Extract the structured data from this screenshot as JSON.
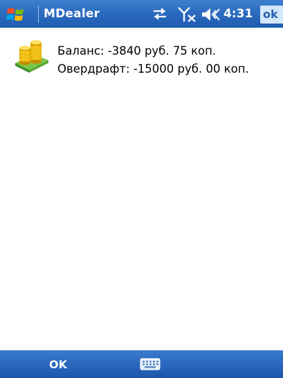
{
  "titlebar": {
    "app_title": "MDealer",
    "time": "4:31",
    "ok_label": "ok",
    "icons": [
      "windows-start-icon",
      "connectivity-icon",
      "no-signal-icon",
      "volume-icon"
    ]
  },
  "account": {
    "balance_text": "Баланс: -3840 руб. 75 коп.",
    "overdraft_text": "Овердрафт: -15000 руб. 00 коп.",
    "icon": "coins-icon"
  },
  "menubar": {
    "left_softkey": "OK",
    "input_icon": "keyboard-icon"
  },
  "colors": {
    "bar_blue": "#2c6cc0",
    "ok_highlight": "#d4e7fb",
    "background": "#ffffff"
  }
}
